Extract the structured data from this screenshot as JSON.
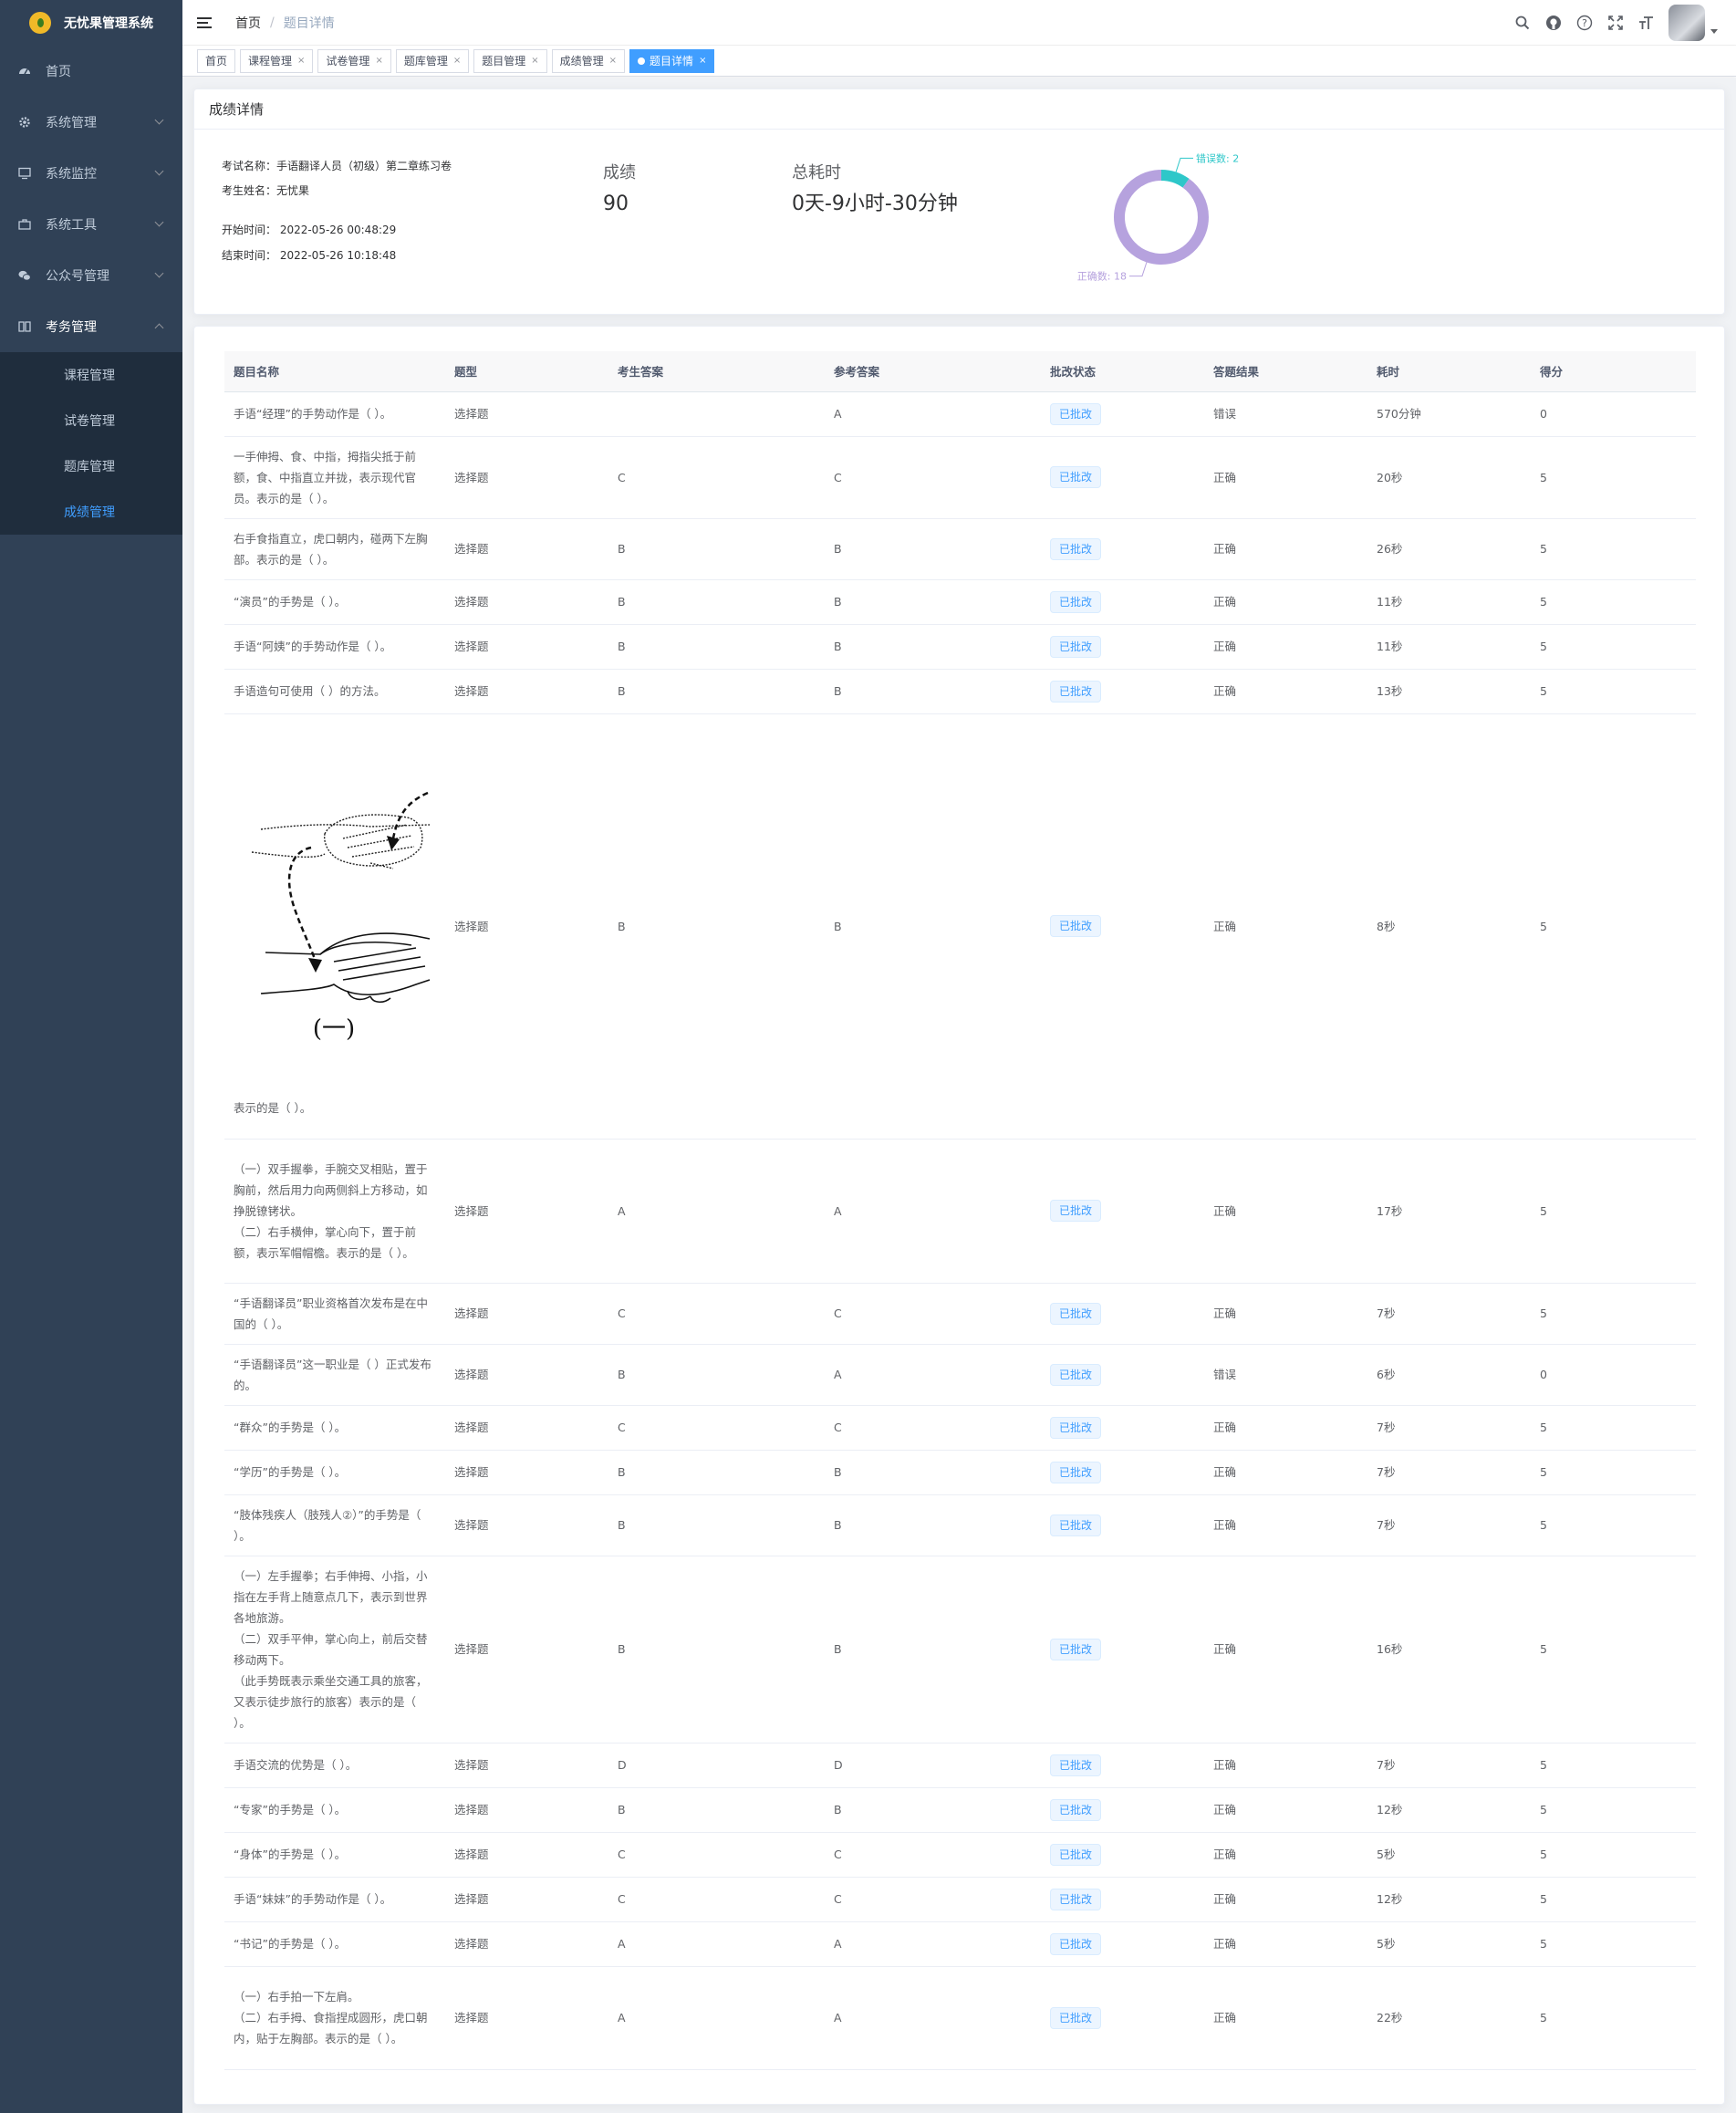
{
  "app": {
    "title": "无忧果管理系统"
  },
  "sidebar": {
    "items": [
      {
        "label": "首页",
        "icon": "dashboard-icon"
      },
      {
        "label": "系统管理",
        "icon": "gear-icon"
      },
      {
        "label": "系统监控",
        "icon": "monitor-icon"
      },
      {
        "label": "系统工具",
        "icon": "toolbox-icon"
      },
      {
        "label": "公众号管理",
        "icon": "wechat-icon"
      },
      {
        "label": "考务管理",
        "icon": "book-icon"
      }
    ],
    "sub_items": [
      "课程管理",
      "试卷管理",
      "题库管理",
      "成绩管理"
    ],
    "active_sub": "成绩管理"
  },
  "navbar": {
    "breadcrumb_home": "首页",
    "breadcrumb_sep": "/",
    "breadcrumb_current": "题目详情"
  },
  "tags": {
    "items": [
      "首页",
      "课程管理",
      "试卷管理",
      "题库管理",
      "题目管理",
      "成绩管理"
    ],
    "active": "题目详情",
    "close": "×"
  },
  "summary": {
    "header": "成绩详情",
    "exam_name": "考试名称：手语翻译人员（初级）第二章练习卷",
    "student_name": "考生姓名：无忧果",
    "start_time": "开始时间：  2022-05-26 00:48:29",
    "end_time": "结束时间：  2022-05-26 10:18:48",
    "score_label": "成绩",
    "score_value": "90",
    "time_label": "总耗时",
    "time_value": "0天-9小时-30分钟",
    "wrong_label": "错误数: 2",
    "correct_label": "正确数: 18"
  },
  "chart_data": {
    "type": "pie",
    "categories": [
      "错误数",
      "正确数"
    ],
    "values": [
      2,
      18
    ],
    "colors": [
      "#2ec7c9",
      "#b6a2de"
    ]
  },
  "table": {
    "headers": [
      "题目名称",
      "题型",
      "考生答案",
      "参考答案",
      "批改状态",
      "答题结果",
      "耗时",
      "得分"
    ],
    "image_row_suffix": "表示的是（   ）。",
    "image_caption": "(一)",
    "rows": [
      {
        "name": "手语“经理”的手势动作是（    ）。",
        "type": "选择题",
        "answer": "",
        "ref": "A",
        "status": "已批改",
        "result": "错误",
        "time": "570分钟",
        "score": "0"
      },
      {
        "name": "一手伸拇、食、中指，拇指尖抵于前额，食、中指直立并拢，表示现代官员。表示的是（   ）。",
        "type": "选择题",
        "answer": "C",
        "ref": "C",
        "status": "已批改",
        "result": "正确",
        "time": "20秒",
        "score": "5"
      },
      {
        "name": "右手食指直立，虎口朝内，碰两下左胸部。表示的是（   ）。",
        "type": "选择题",
        "answer": "B",
        "ref": "B",
        "status": "已批改",
        "result": "正确",
        "time": "26秒",
        "score": "5"
      },
      {
        "name": "“演员”的手势是（   ）。",
        "type": "选择题",
        "answer": "B",
        "ref": "B",
        "status": "已批改",
        "result": "正确",
        "time": "11秒",
        "score": "5"
      },
      {
        "name": "手语“阿姨”的手势动作是（   ）。",
        "type": "选择题",
        "answer": "B",
        "ref": "B",
        "status": "已批改",
        "result": "正确",
        "time": "11秒",
        "score": "5"
      },
      {
        "name": "手语造句可使用（        ）的方法。",
        "type": "选择题",
        "answer": "B",
        "ref": "B",
        "status": "已批改",
        "result": "正确",
        "time": "13秒",
        "score": "5"
      },
      {
        "name": "",
        "type": "选择题",
        "answer": "B",
        "ref": "B",
        "status": "已批改",
        "result": "正确",
        "time": "8秒",
        "score": "5"
      },
      {
        "name": "（一）双手握拳，手腕交叉相贴，置于胸前，然后用力向两侧斜上方移动，如挣脱镣铐状。\n（二）右手横伸，掌心向下，置于前额，表示军帽帽檐。表示的是（   ）。",
        "type": "选择题",
        "answer": "A",
        "ref": "A",
        "status": "已批改",
        "result": "正确",
        "time": "17秒",
        "score": "5"
      },
      {
        "name": "“手语翻译员”职业资格首次发布是在中国的（        ）。",
        "type": "选择题",
        "answer": "C",
        "ref": "C",
        "status": "已批改",
        "result": "正确",
        "time": "7秒",
        "score": "5"
      },
      {
        "name": "“手语翻译员”这一职业是（        ）正式发布的。",
        "type": "选择题",
        "answer": "B",
        "ref": "A",
        "status": "已批改",
        "result": "错误",
        "time": "6秒",
        "score": "0"
      },
      {
        "name": "“群众”的手势是（   ）。",
        "type": "选择题",
        "answer": "C",
        "ref": "C",
        "status": "已批改",
        "result": "正确",
        "time": "7秒",
        "score": "5"
      },
      {
        "name": "“学历”的手势是（   ）。",
        "type": "选择题",
        "answer": "B",
        "ref": "B",
        "status": "已批改",
        "result": "正确",
        "time": "7秒",
        "score": "5"
      },
      {
        "name": "“肢体残疾人（肢残人②）”的手势是（   ）。",
        "type": "选择题",
        "answer": "B",
        "ref": "B",
        "status": "已批改",
        "result": "正确",
        "time": "7秒",
        "score": "5"
      },
      {
        "name": "（一）左手握拳；右手伸拇、小指，小指在左手背上随意点几下，表示到世界各地旅游。\n（二）双手平伸，掌心向上，前后交替移动两下。\n（此手势既表示乘坐交通工具的旅客，又表示徒步旅行的旅客）表示的是（   ）。",
        "type": "选择题",
        "answer": "B",
        "ref": "B",
        "status": "已批改",
        "result": "正确",
        "time": "16秒",
        "score": "5"
      },
      {
        "name": "手语交流的优势是（        ）。",
        "type": "选择题",
        "answer": "D",
        "ref": "D",
        "status": "已批改",
        "result": "正确",
        "time": "7秒",
        "score": "5"
      },
      {
        "name": "“专家”的手势是（   ）。",
        "type": "选择题",
        "answer": "B",
        "ref": "B",
        "status": "已批改",
        "result": "正确",
        "time": "12秒",
        "score": "5"
      },
      {
        "name": "“身体”的手势是（   ）。",
        "type": "选择题",
        "answer": "C",
        "ref": "C",
        "status": "已批改",
        "result": "正确",
        "time": "5秒",
        "score": "5"
      },
      {
        "name": "手语“妹妹”的手势动作是（   ）。",
        "type": "选择题",
        "answer": "C",
        "ref": "C",
        "status": "已批改",
        "result": "正确",
        "time": "12秒",
        "score": "5"
      },
      {
        "name": "“书记”的手势是（   ）。",
        "type": "选择题",
        "answer": "A",
        "ref": "A",
        "status": "已批改",
        "result": "正确",
        "time": "5秒",
        "score": "5"
      },
      {
        "name": "（一）右手拍一下左肩。\n（二）右手拇、食指捏成圆形，虎口朝内，贴于左胸部。表示的是（   ）。",
        "type": "选择题",
        "answer": "A",
        "ref": "A",
        "status": "已批改",
        "result": "正确",
        "time": "22秒",
        "score": "5"
      }
    ]
  }
}
